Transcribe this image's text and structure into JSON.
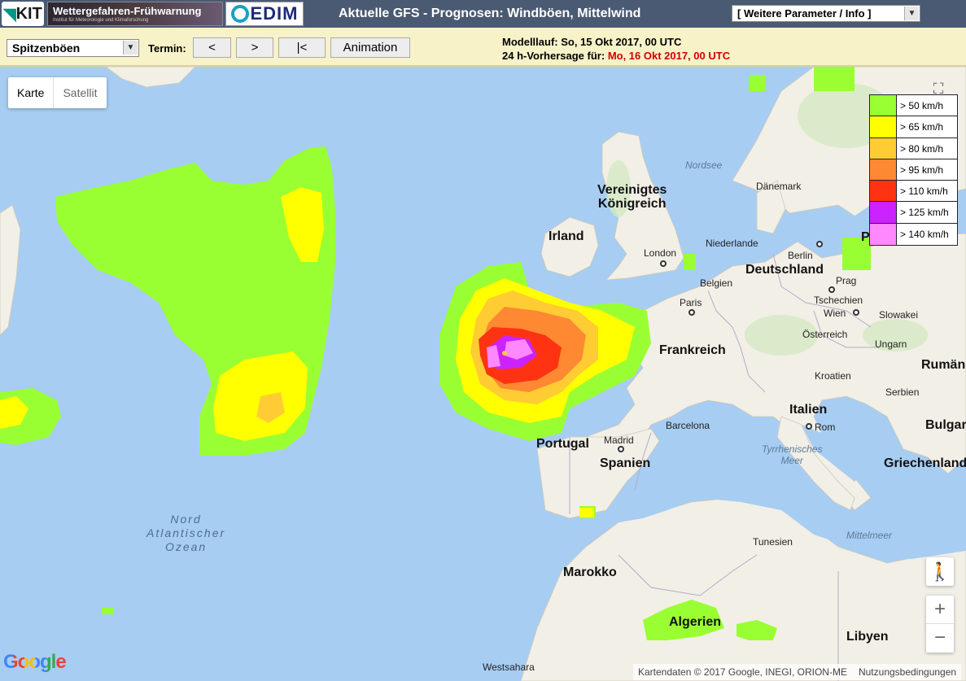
{
  "header": {
    "logo_kit": "KIT",
    "logo_wfw_title": "Wettergefahren-Frühwarnung",
    "logo_wfw_sub": "Institut für Meteorologie und Klimaforschung",
    "logo_cedim": "EDIM",
    "title": "Aktuelle GFS - Prognosen: Windböen, Mittelwind",
    "param_select": "[ Weitere Parameter / Info ]"
  },
  "toolbar": {
    "type_select": "Spitzenböen",
    "termin_label": "Termin:",
    "btn_prev": "<",
    "btn_next": ">",
    "btn_first": "|<",
    "btn_animation": "Animation",
    "run_label": "Modelllauf: So, 15 Okt 2017, 00 UTC",
    "forecast_label": "24 h-Vorhersage für:",
    "forecast_date": "Mo, 16 Okt 2017, 00 UTC"
  },
  "map": {
    "maptype_karte": "Karte",
    "maptype_satellit": "Satellit",
    "google_logo": "Google",
    "attribution": "Kartendaten © 2017 Google, INEGI, ORION-ME",
    "terms": "Nutzungsbedingungen",
    "labels": {
      "uk": "Vereinigtes\nKönigreich",
      "irland": "Irland",
      "london": "London",
      "nordsee": "Nordsee",
      "daenemark": "Dänemark",
      "niederlande": "Niederlande",
      "berlin": "Berlin",
      "deutschland": "Deutschland",
      "belgien": "Belgien",
      "prag": "Prag",
      "paris": "Paris",
      "tschechien": "Tschechien",
      "wien": "Wien",
      "slowakei": "Slowakei",
      "oesterreich": "Österreich",
      "ungarn": "Ungarn",
      "rumaen": "Rumän",
      "frankreich": "Frankreich",
      "kroatien": "Kroatien",
      "serbien": "Serbien",
      "italien": "Italien",
      "rom": "Rom",
      "bulgar": "Bulgar",
      "barcelona": "Barcelona",
      "madrid": "Madrid",
      "portugal": "Portugal",
      "spanien": "Spanien",
      "tyrrhen": "Tyrrhenisches\nMeer",
      "griechenland": "Griechenland",
      "nordatlantik": "Nord\nAtlantischer\nOzean",
      "mittelmeer": "Mittelmeer",
      "tunesien": "Tunesien",
      "marokko": "Marokko",
      "algerien": "Algerien",
      "libyen": "Libyen",
      "westsahara": "Westsahara",
      "p_edge": "P"
    }
  },
  "legend": [
    {
      "label": "> 50 km/h",
      "color": "#99ff33"
    },
    {
      "label": "> 65 km/h",
      "color": "#ffff00"
    },
    {
      "label": "> 80 km/h",
      "color": "#ffcc33"
    },
    {
      "label": "> 95 km/h",
      "color": "#ff8833"
    },
    {
      "label": "> 110 km/h",
      "color": "#ff3311"
    },
    {
      "label": "> 125 km/h",
      "color": "#cc22ff"
    },
    {
      "label": "> 140 km/h",
      "color": "#ff88ff"
    }
  ]
}
